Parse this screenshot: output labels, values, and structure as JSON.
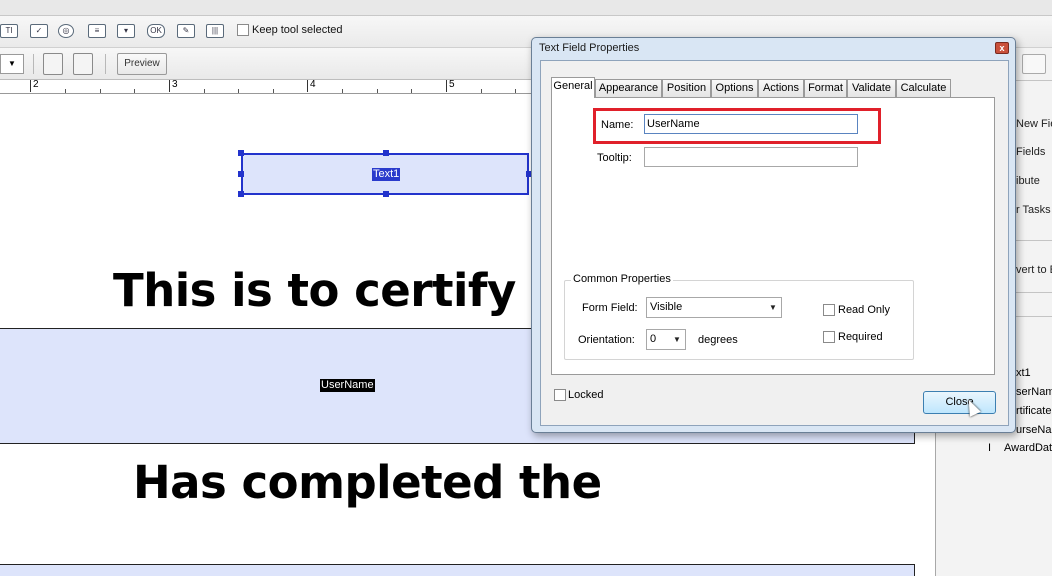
{
  "toolbar": {
    "keep_tool_label": "Keep tool selected",
    "preview_label": "Preview",
    "dropdown_glyph": "▼",
    "form_icons": [
      "text-field-icon",
      "checkbox-icon",
      "radio-button-icon",
      "list-box-icon",
      "dropdown-icon",
      "button-icon",
      "digital-signature-icon",
      "barcode-icon"
    ],
    "ok_icon_text": "OK"
  },
  "ruler": {
    "marks": [
      "2",
      "3",
      "4",
      "5"
    ]
  },
  "document": {
    "text1_field_label": "Text1",
    "heading1": "This is to certify tha",
    "username_field_label": "UserName",
    "heading2": "Has completed the"
  },
  "right_panel": {
    "tasks": [
      "New Fie",
      "Fields",
      "ibute",
      "r Tasks",
      "vert to E"
    ],
    "fields": [
      "xt1",
      "serName",
      "rtificate",
      "urseNa",
      "AwardDat"
    ]
  },
  "dialog": {
    "title": "Text Field Properties",
    "close_glyph": "x",
    "tabs": [
      "General",
      "Appearance",
      "Position",
      "Options",
      "Actions",
      "Format",
      "Validate",
      "Calculate"
    ],
    "active_tab": "General",
    "name_label": "Name:",
    "name_value": "UserName",
    "tooltip_label": "Tooltip:",
    "tooltip_value": "",
    "common_properties_title": "Common Properties",
    "form_field_label": "Form Field:",
    "form_field_value": "Visible",
    "orientation_label": "Orientation:",
    "orientation_value": "0",
    "degrees_label": "degrees",
    "read_only_label": "Read Only",
    "required_label": "Required",
    "locked_label": "Locked",
    "close_button_label": "Close",
    "select_arrow": "▼",
    "highlight_color": "#e0202a"
  }
}
